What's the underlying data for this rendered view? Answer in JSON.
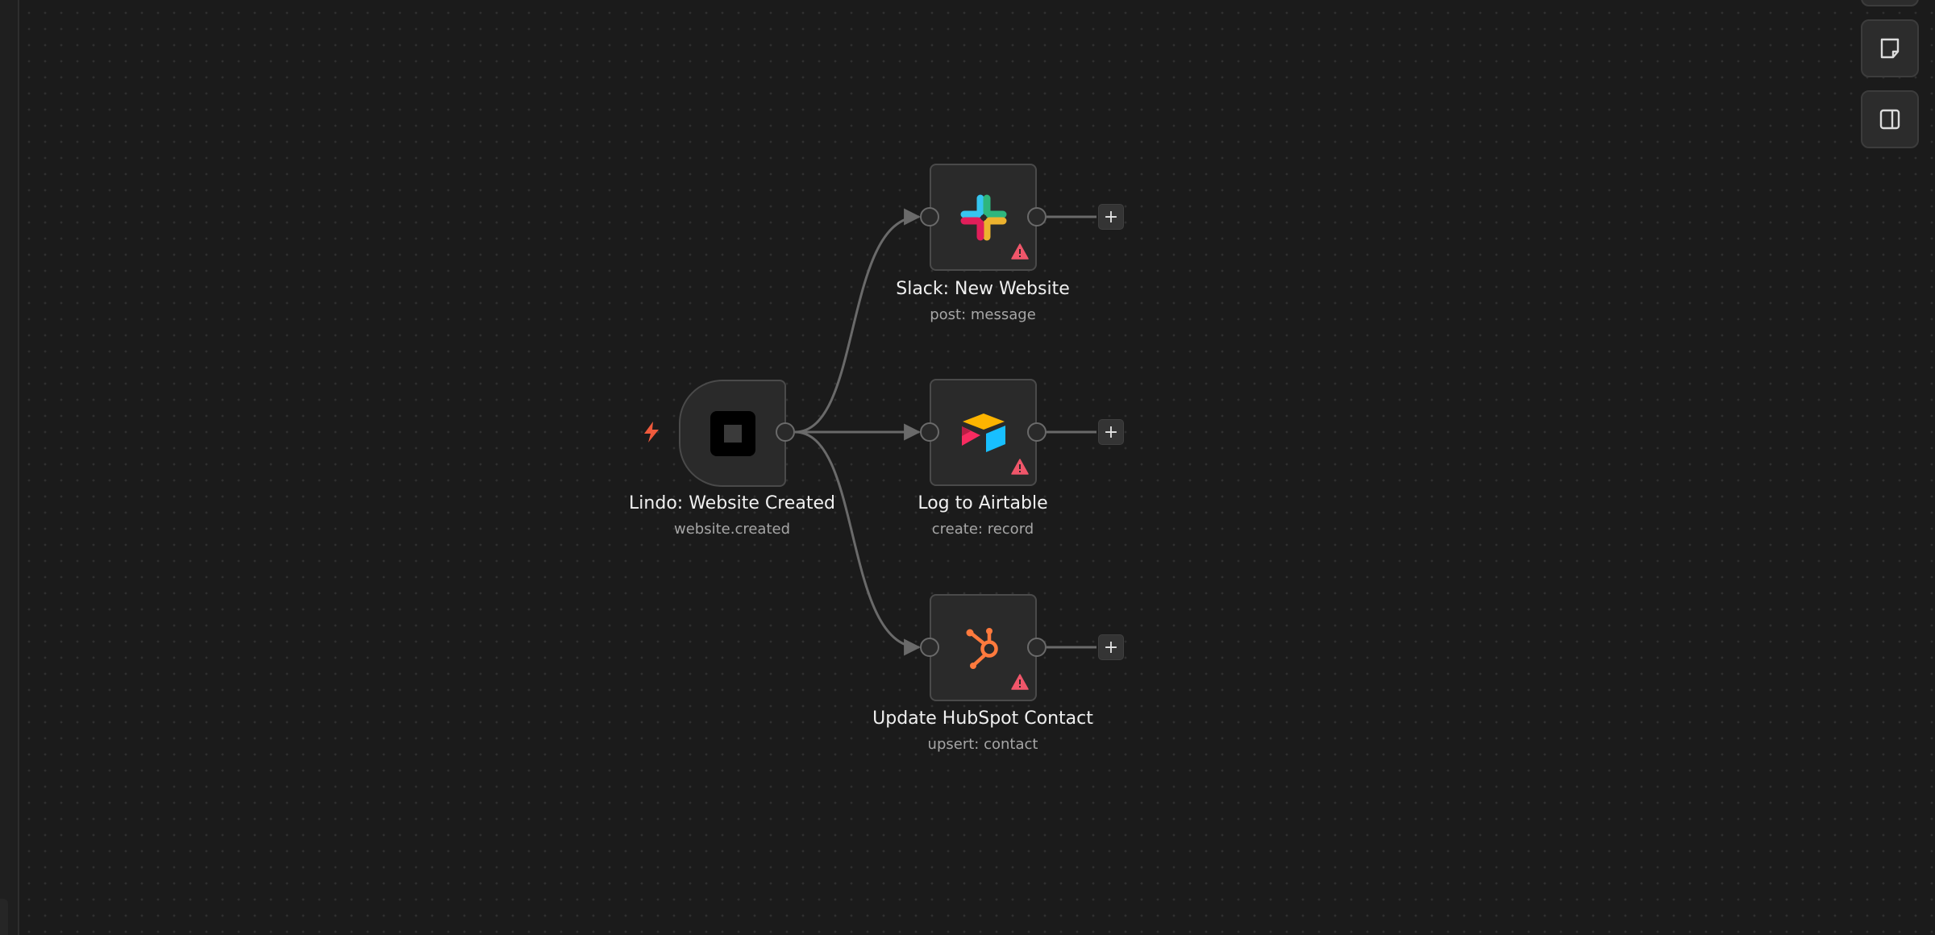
{
  "workflow": {
    "trigger": {
      "title": "Lindo: Website Created",
      "subtitle": "website.created",
      "icon": "stop-square-icon",
      "badge_icon": "lightning-bolt-icon"
    },
    "actions": [
      {
        "title": "Slack: New Website",
        "subtitle": "post: message",
        "icon": "slack-icon",
        "status_icon": "warning-icon"
      },
      {
        "title": "Log to Airtable",
        "subtitle": "create: record",
        "icon": "airtable-icon",
        "status_icon": "warning-icon"
      },
      {
        "title": "Update HubSpot Contact",
        "subtitle": "upsert: contact",
        "icon": "hubspot-icon",
        "status_icon": "warning-icon"
      }
    ],
    "add_label": "+"
  },
  "toolbar": {
    "buttons": [
      {
        "name": "sticky-note-icon"
      },
      {
        "name": "side-panel-icon"
      }
    ]
  },
  "colors": {
    "canvas_bg": "#1b1b1b",
    "node_bg": "#2a2a2a",
    "node_border": "#4a4a4a",
    "edge": "#6a6a6a",
    "warning": "#f0566a",
    "bolt": "#ef5a3c",
    "hubspot": "#ff7a3d"
  }
}
